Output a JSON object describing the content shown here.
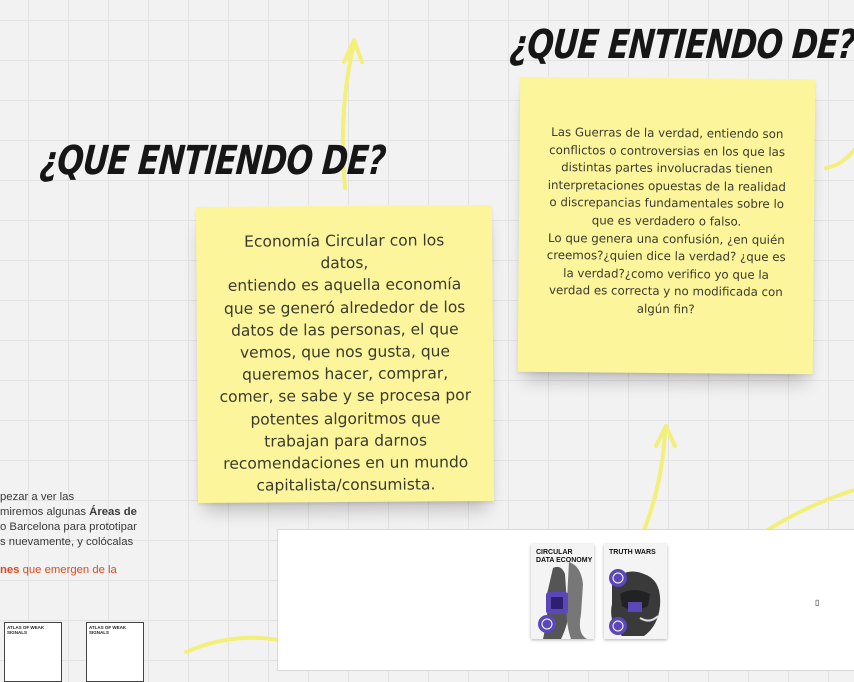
{
  "headings": {
    "left": "¿QUE ENTIENDO DE?",
    "right": "¿QUE ENTIENDO DE?"
  },
  "notes": [
    {
      "text": "Economía Circular con los datos,\nentiendo es aquella economía\nque se generó alrededor de los\ndatos de las personas, el que\nvemos, que nos gusta, que\nqueremos hacer, comprar,\ncomer, se sabe y se procesa por\npotentes algoritmos que\ntrabajan para darnos\nrecomendaciones en un mundo\ncapitalista/consumista.",
      "color": "#fdf59c"
    },
    {
      "text": "Las Guerras de la verdad, entiendo son\nconflictos o controversias en los que las\ndistintas partes involucradas tienen\ninterpretaciones opuestas de la realidad\no discrepancias  fundamentales sobre lo\nque es verdadero o falso.\nLo que genera una confusión, ¿en quién\ncreemos?¿quien dice la verdad? ¿que es\nla verdad?¿como verifico yo que la\nverdad es correcta y no modificada con\nalgún fin?",
      "color": "#fdf59c"
    }
  ],
  "cards": [
    {
      "title": "CIRCULAR\nDATA ECONOMY"
    },
    {
      "title": "TRUTH WARS"
    }
  ],
  "sidebar_text": {
    "line1": "pezar a ver las",
    "line2_pre": "miremos algunas ",
    "line2_bold": "Áreas de",
    "line3": "o Barcelona para prototipar",
    "line4": "s nuevamente, y colócalas",
    "line5_accent": "nes",
    "line5_rest": " que emergen de la"
  },
  "weak_signal_cards": [
    {
      "title": "ATLAS OF WEAK SIGNALS"
    },
    {
      "title": "ATLAS OF WEAK SIGNALS"
    }
  ],
  "misc": {
    "small_glyph": "▯"
  },
  "colors": {
    "sticky": "#fdf59c",
    "arrow": "#f3f07a",
    "accent": "#e04a1a",
    "card_purple": "#5b47b8"
  }
}
